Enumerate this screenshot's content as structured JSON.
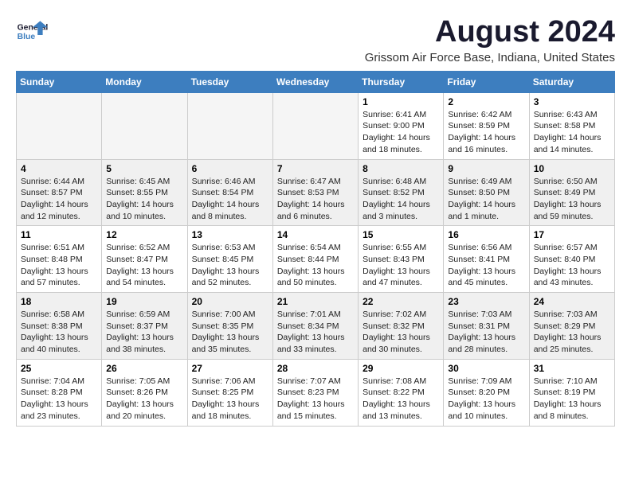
{
  "logo": {
    "line1": "General",
    "line2": "Blue"
  },
  "title": "August 2024",
  "subtitle": "Grissom Air Force Base, Indiana, United States",
  "days_of_week": [
    "Sunday",
    "Monday",
    "Tuesday",
    "Wednesday",
    "Thursday",
    "Friday",
    "Saturday"
  ],
  "weeks": [
    [
      {
        "day": "",
        "info": ""
      },
      {
        "day": "",
        "info": ""
      },
      {
        "day": "",
        "info": ""
      },
      {
        "day": "",
        "info": ""
      },
      {
        "day": "1",
        "info": "Sunrise: 6:41 AM\nSunset: 9:00 PM\nDaylight: 14 hours\nand 18 minutes."
      },
      {
        "day": "2",
        "info": "Sunrise: 6:42 AM\nSunset: 8:59 PM\nDaylight: 14 hours\nand 16 minutes."
      },
      {
        "day": "3",
        "info": "Sunrise: 6:43 AM\nSunset: 8:58 PM\nDaylight: 14 hours\nand 14 minutes."
      }
    ],
    [
      {
        "day": "4",
        "info": "Sunrise: 6:44 AM\nSunset: 8:57 PM\nDaylight: 14 hours\nand 12 minutes."
      },
      {
        "day": "5",
        "info": "Sunrise: 6:45 AM\nSunset: 8:55 PM\nDaylight: 14 hours\nand 10 minutes."
      },
      {
        "day": "6",
        "info": "Sunrise: 6:46 AM\nSunset: 8:54 PM\nDaylight: 14 hours\nand 8 minutes."
      },
      {
        "day": "7",
        "info": "Sunrise: 6:47 AM\nSunset: 8:53 PM\nDaylight: 14 hours\nand 6 minutes."
      },
      {
        "day": "8",
        "info": "Sunrise: 6:48 AM\nSunset: 8:52 PM\nDaylight: 14 hours\nand 3 minutes."
      },
      {
        "day": "9",
        "info": "Sunrise: 6:49 AM\nSunset: 8:50 PM\nDaylight: 14 hours\nand 1 minute."
      },
      {
        "day": "10",
        "info": "Sunrise: 6:50 AM\nSunset: 8:49 PM\nDaylight: 13 hours\nand 59 minutes."
      }
    ],
    [
      {
        "day": "11",
        "info": "Sunrise: 6:51 AM\nSunset: 8:48 PM\nDaylight: 13 hours\nand 57 minutes."
      },
      {
        "day": "12",
        "info": "Sunrise: 6:52 AM\nSunset: 8:47 PM\nDaylight: 13 hours\nand 54 minutes."
      },
      {
        "day": "13",
        "info": "Sunrise: 6:53 AM\nSunset: 8:45 PM\nDaylight: 13 hours\nand 52 minutes."
      },
      {
        "day": "14",
        "info": "Sunrise: 6:54 AM\nSunset: 8:44 PM\nDaylight: 13 hours\nand 50 minutes."
      },
      {
        "day": "15",
        "info": "Sunrise: 6:55 AM\nSunset: 8:43 PM\nDaylight: 13 hours\nand 47 minutes."
      },
      {
        "day": "16",
        "info": "Sunrise: 6:56 AM\nSunset: 8:41 PM\nDaylight: 13 hours\nand 45 minutes."
      },
      {
        "day": "17",
        "info": "Sunrise: 6:57 AM\nSunset: 8:40 PM\nDaylight: 13 hours\nand 43 minutes."
      }
    ],
    [
      {
        "day": "18",
        "info": "Sunrise: 6:58 AM\nSunset: 8:38 PM\nDaylight: 13 hours\nand 40 minutes."
      },
      {
        "day": "19",
        "info": "Sunrise: 6:59 AM\nSunset: 8:37 PM\nDaylight: 13 hours\nand 38 minutes."
      },
      {
        "day": "20",
        "info": "Sunrise: 7:00 AM\nSunset: 8:35 PM\nDaylight: 13 hours\nand 35 minutes."
      },
      {
        "day": "21",
        "info": "Sunrise: 7:01 AM\nSunset: 8:34 PM\nDaylight: 13 hours\nand 33 minutes."
      },
      {
        "day": "22",
        "info": "Sunrise: 7:02 AM\nSunset: 8:32 PM\nDaylight: 13 hours\nand 30 minutes."
      },
      {
        "day": "23",
        "info": "Sunrise: 7:03 AM\nSunset: 8:31 PM\nDaylight: 13 hours\nand 28 minutes."
      },
      {
        "day": "24",
        "info": "Sunrise: 7:03 AM\nSunset: 8:29 PM\nDaylight: 13 hours\nand 25 minutes."
      }
    ],
    [
      {
        "day": "25",
        "info": "Sunrise: 7:04 AM\nSunset: 8:28 PM\nDaylight: 13 hours\nand 23 minutes."
      },
      {
        "day": "26",
        "info": "Sunrise: 7:05 AM\nSunset: 8:26 PM\nDaylight: 13 hours\nand 20 minutes."
      },
      {
        "day": "27",
        "info": "Sunrise: 7:06 AM\nSunset: 8:25 PM\nDaylight: 13 hours\nand 18 minutes."
      },
      {
        "day": "28",
        "info": "Sunrise: 7:07 AM\nSunset: 8:23 PM\nDaylight: 13 hours\nand 15 minutes."
      },
      {
        "day": "29",
        "info": "Sunrise: 7:08 AM\nSunset: 8:22 PM\nDaylight: 13 hours\nand 13 minutes."
      },
      {
        "day": "30",
        "info": "Sunrise: 7:09 AM\nSunset: 8:20 PM\nDaylight: 13 hours\nand 10 minutes."
      },
      {
        "day": "31",
        "info": "Sunrise: 7:10 AM\nSunset: 8:19 PM\nDaylight: 13 hours\nand 8 minutes."
      }
    ]
  ]
}
